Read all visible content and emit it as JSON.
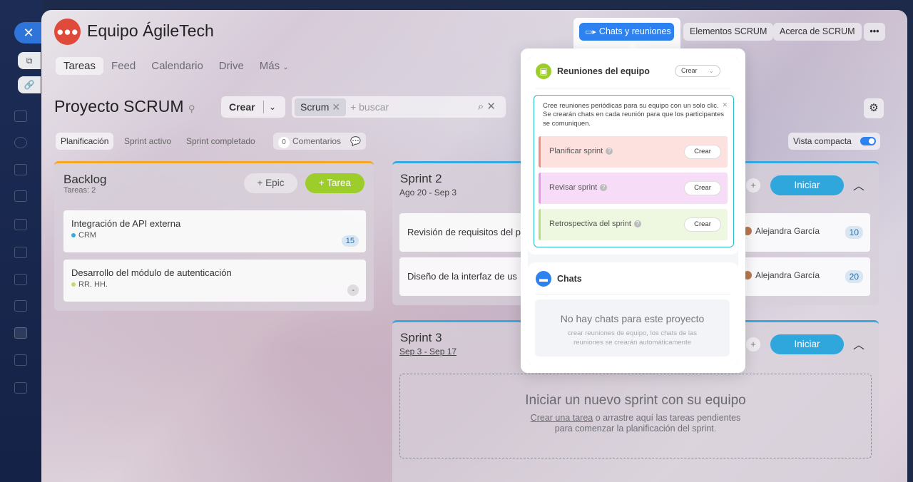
{
  "app": {
    "title": "Equipo ÁgileTech"
  },
  "tabs": [
    "Tareas",
    "Feed",
    "Calendario",
    "Drive",
    "Más"
  ],
  "top_buttons": {
    "chats": "Chats y reuniones",
    "elements": "Elementos SCRUM",
    "about": "Acerca de SCRUM",
    "more": "•••"
  },
  "project": {
    "title": "Proyecto SCRUM",
    "create": "Crear",
    "chip": "Scrum",
    "search_placeholder": "+ buscar"
  },
  "subtabs": {
    "planning": "Planificación",
    "active": "Sprint activo",
    "completed": "Sprint completado",
    "comments_count": "0",
    "comments": "Comentarios",
    "compact": "Vista compacta"
  },
  "backlog": {
    "title": "Backlog",
    "count": "Tareas: 2",
    "epic": "+ Epic",
    "task": "+ Tarea",
    "items": [
      {
        "title": "Integración de API externa",
        "tag": "CRM",
        "points": "15"
      },
      {
        "title": "Desarrollo del módulo de autenticación",
        "tag": "RR. HH.",
        "points": "-"
      }
    ]
  },
  "sprint2": {
    "title": "Sprint 2",
    "dates": "Ago 20 - Sep 3",
    "start": "Iniciar",
    "items": [
      {
        "title": "Revisión de requisitos del p",
        "user": "Alejandra García",
        "points": "10"
      },
      {
        "title": "Diseño de la interfaz de us",
        "user": "Alejandra García",
        "points": "20"
      }
    ]
  },
  "sprint3": {
    "title": "Sprint 3",
    "dates": "Sep 3 - Sep 17",
    "start": "Iniciar",
    "empty_title": "Iniciar un nuevo sprint con su equipo",
    "empty_link": "Crear una tarea",
    "empty_text1": " o arrastre aquí las tareas pendientes",
    "empty_text2": "para comenzar la planificación del sprint."
  },
  "popup": {
    "meetings_title": "Reuniones del equipo",
    "meetings_create": "Crear",
    "desc": "Cree reuniones periódicas para su equipo con un solo clic. Se crearán chats en cada reunión para que los participantes se comuniquen.",
    "rows": [
      {
        "label": "Planificar sprint",
        "action": "Crear"
      },
      {
        "label": "Revisar sprint",
        "action": "Crear"
      },
      {
        "label": "Retrospectiva del sprint",
        "action": "Crear"
      }
    ],
    "chats_title": "Chats",
    "no_chats": "No hay chats para este proyecto",
    "no_chats_sub": "crear reuniones de equipo, los chats de las reuniones se crearán automáticamente"
  },
  "colors": {
    "accent_blue": "#2e82f0",
    "green": "#9ccd2b",
    "teal": "#2bb8c8",
    "orange": "#f5a623",
    "row1": "#fde1df",
    "row2": "#f7dcf7",
    "row3": "#eef7df"
  }
}
